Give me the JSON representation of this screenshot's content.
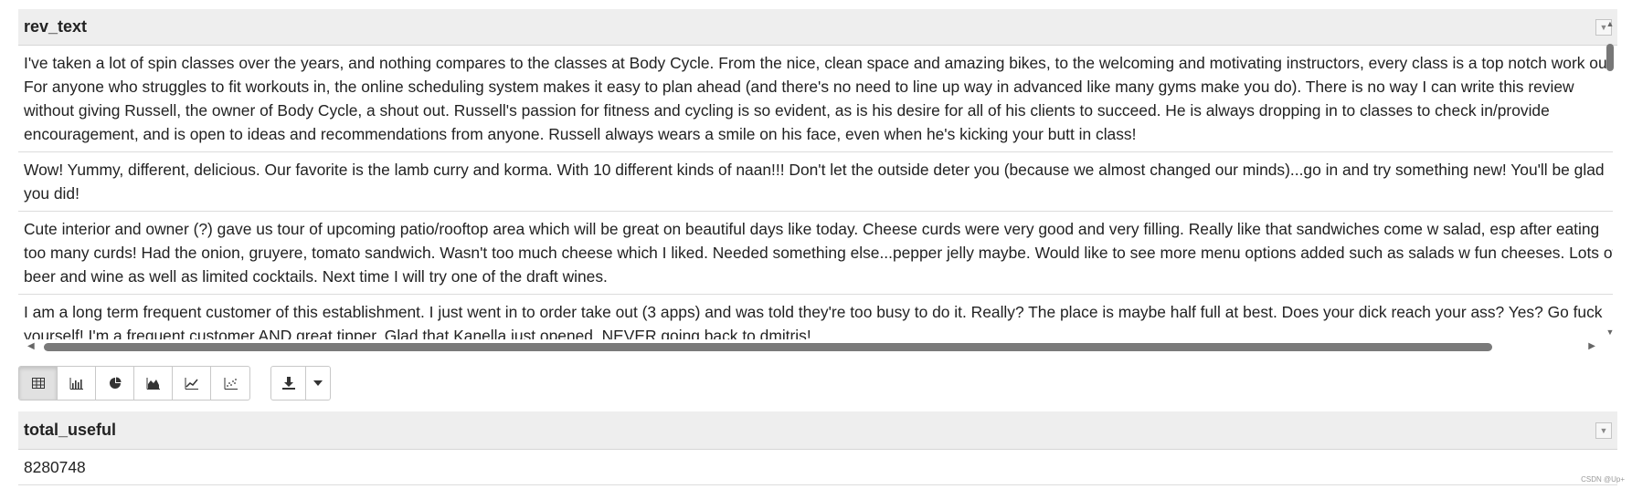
{
  "table1": {
    "column": "rev_text",
    "rows": [
      "I've taken a lot of spin classes over the years, and nothing compares to the classes at Body Cycle. From the nice, clean space and amazing bikes, to the welcoming and motivating instructors, every class is a top notch work ou For anyone who struggles to fit workouts in, the online scheduling system makes it easy to plan ahead (and there's no need to line up way in advanced like many gyms make you do). There is no way I can write this review without giving Russell, the owner of Body Cycle, a shout out. Russell's passion for fitness and cycling is so evident, as is his desire for all of his clients to succeed. He is always dropping in to classes to check in/provide encouragement, and is open to ideas and recommendations from anyone. Russell always wears a smile on his face, even when he's kicking your butt in class!",
      "Wow! Yummy, different, delicious. Our favorite is the lamb curry and korma. With 10 different kinds of naan!!! Don't let the outside deter you (because we almost changed our minds)...go in and try something new! You'll be glad you did!",
      "Cute interior and owner (?) gave us tour of upcoming patio/rooftop area which will be great on beautiful days like today. Cheese curds were very good and very filling. Really like that sandwiches come w salad, esp after eating too many curds! Had the onion, gruyere, tomato sandwich. Wasn't too much cheese which I liked. Needed something else...pepper jelly maybe. Would like to see more menu options added such as salads w fun cheeses. Lots of beer and wine as well as limited cocktails. Next time I will try one of the draft wines.",
      "I am a long term frequent customer of this establishment. I just went in to order take out (3 apps) and was told they're too busy to do it. Really? The place is maybe half full at best. Does your dick reach your ass? Yes? Go fuck yourself! I'm a frequent customer AND great tipper. Glad that Kanella just opened. NEVER going back to dmitris!"
    ]
  },
  "toolbar": {
    "view_buttons": [
      "table-icon",
      "bar-chart-icon",
      "pie-chart-icon",
      "area-chart-icon",
      "line-chart-icon",
      "scatter-chart-icon"
    ],
    "active": "table-icon",
    "download": "download-icon",
    "dropdown": "caret-down-icon"
  },
  "table2": {
    "column": "total_useful",
    "rows": [
      "8280748"
    ]
  },
  "watermark": "CSDN @Up+"
}
